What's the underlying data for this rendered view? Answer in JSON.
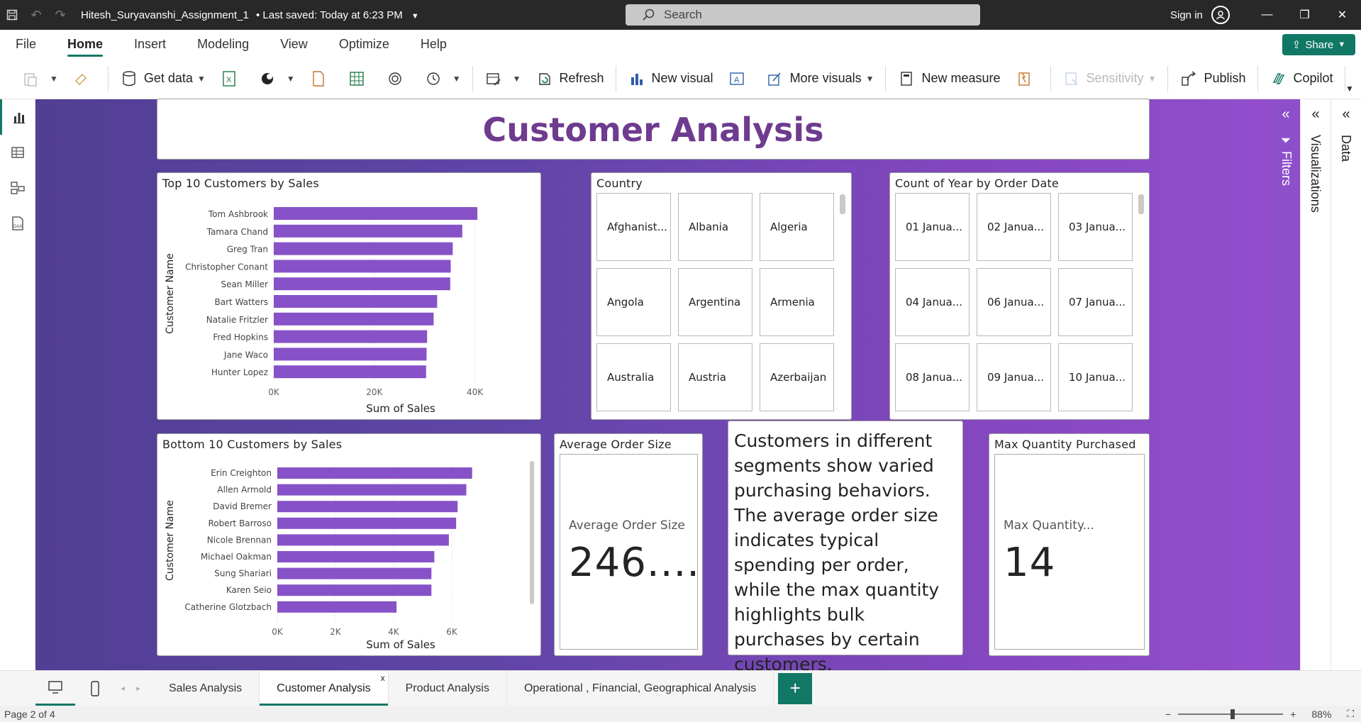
{
  "titlebar": {
    "doc_name": "Hitesh_Suryavanshi_Assignment_1",
    "saved": "• Last saved: Today at 6:23 PM",
    "search_placeholder": "Search",
    "signin": "Sign in"
  },
  "menu": {
    "items": [
      "File",
      "Home",
      "Insert",
      "Modeling",
      "View",
      "Optimize",
      "Help"
    ],
    "share": "Share"
  },
  "ribbon": {
    "get_data": "Get data",
    "refresh": "Refresh",
    "new_visual": "New visual",
    "more_visuals": "More visuals",
    "new_measure": "New measure",
    "sensitivity": "Sensitivity",
    "publish": "Publish",
    "copilot": "Copilot"
  },
  "report": {
    "title": "Customer Analysis"
  },
  "top10": {
    "title": "Top 10 Customers by Sales",
    "ylabel": "Customer Name",
    "xlabel": "Sum of Sales"
  },
  "bottom10": {
    "title": "Bottom 10 Customers by Sales",
    "ylabel": "Customer Name",
    "xlabel": "Sum of Sales"
  },
  "country_slicer": {
    "title": "Country",
    "items": [
      "Afghanist...",
      "Albania",
      "Algeria",
      "Angola",
      "Argentina",
      "Armenia",
      "Australia",
      "Austria",
      "Azerbaijan"
    ]
  },
  "year_slicer": {
    "title": "Count of Year by Order Date",
    "items": [
      "01 Janua...",
      "02 Janua...",
      "03 Janua...",
      "04 Janua...",
      "06 Janua...",
      "07 Janua...",
      "08 Janua...",
      "09 Janua...",
      "10 Janua..."
    ]
  },
  "avg_card": {
    "title": "Average Order Size",
    "label": "Average Order Size",
    "value": "246...."
  },
  "insight": {
    "text": "Customers in different segments show varied purchasing behaviors. The average order size indicates typical spending per order, while the max quantity highlights bulk purchases by certain customers."
  },
  "max_card": {
    "title": "Max Quantity Purchased",
    "label": "Max Quantity...",
    "value": "14"
  },
  "tabs": [
    "Sales Analysis",
    "Customer Analysis",
    "Product Analysis",
    "Operational , Financial, Geographical Analysis"
  ],
  "status": {
    "page": "Page 2 of 4",
    "zoom": "88%"
  },
  "colors": {
    "bar": "#8752c7",
    "accent": "#117865",
    "title": "#6e3b8f"
  },
  "chart_data": [
    {
      "type": "bar",
      "orientation": "horizontal",
      "title": "Top 10 Customers by Sales",
      "xlabel": "Sum of Sales",
      "ylabel": "Customer Name",
      "categories": [
        "Tom Ashbrook",
        "Tamara Chand",
        "Greg Tran",
        "Christopher Conant",
        "Sean Miller",
        "Bart Watters",
        "Natalie Fritzler",
        "Fred Hopkins",
        "Jane Waco",
        "Hunter Lopez"
      ],
      "values": [
        40500,
        37500,
        35600,
        35200,
        35100,
        32500,
        31800,
        30500,
        30400,
        30300
      ],
      "xlim": [
        0,
        45000
      ],
      "ticks": [
        "0K",
        "20K",
        "40K"
      ],
      "grid": true
    },
    {
      "type": "bar",
      "orientation": "horizontal",
      "title": "Bottom 10 Customers by Sales",
      "xlabel": "Sum of Sales",
      "ylabel": "Customer Name",
      "categories": [
        "Erin Creighton",
        "Allen Armold",
        "David Bremer",
        "Robert Barroso",
        "Nicole Brennan",
        "Michael Oakman",
        "Sung Shariari",
        "Karen Seio",
        "Catherine Glotzbach"
      ],
      "values": [
        6700,
        6500,
        6200,
        6150,
        5900,
        5400,
        5300,
        5300,
        4100
      ],
      "xlim": [
        0,
        7000
      ],
      "ticks": [
        "0K",
        "2K",
        "4K",
        "6K"
      ],
      "grid": true
    }
  ]
}
